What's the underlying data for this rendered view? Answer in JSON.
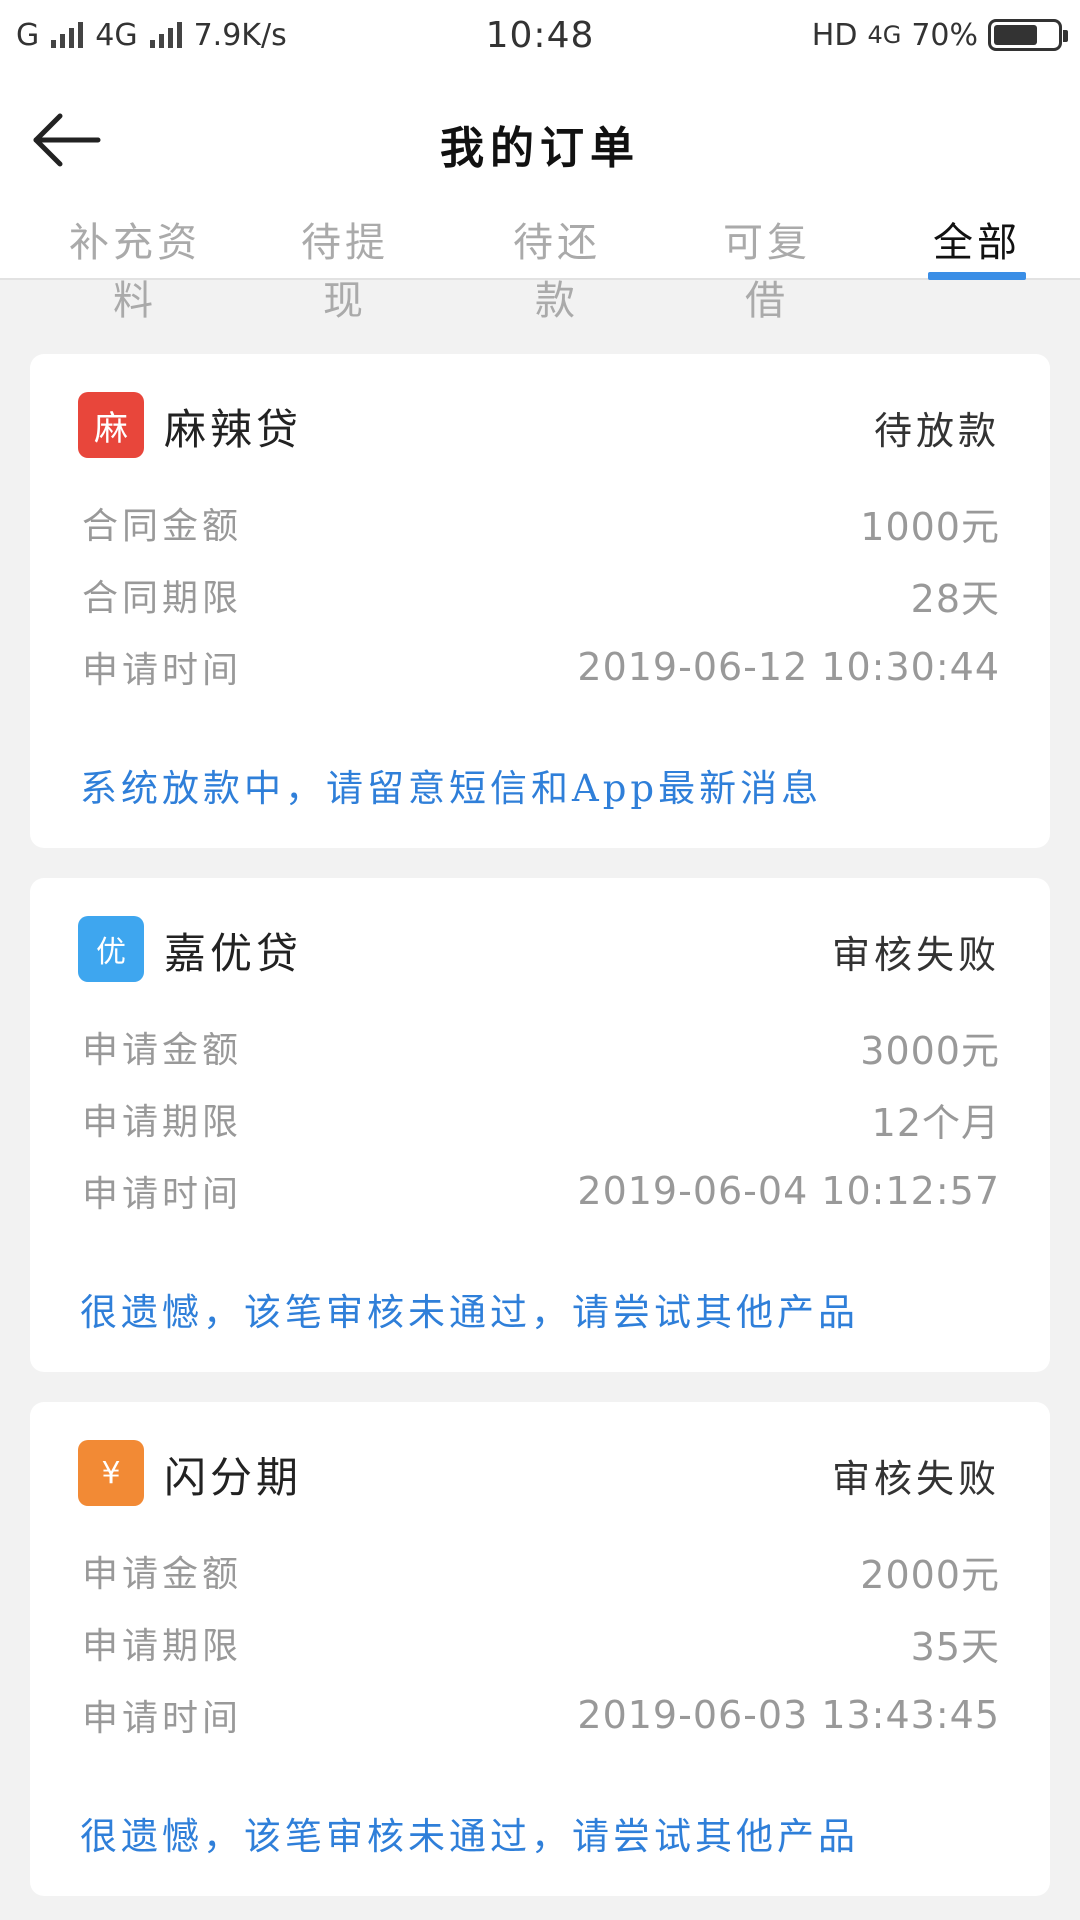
{
  "status_bar": {
    "carrier": "G",
    "network": "4G",
    "speed": "7.9K/s",
    "time": "10:48",
    "hd": "HD",
    "net2": "4G",
    "battery_text": "70%",
    "battery_level": 0.7
  },
  "header": {
    "title": "我的订单",
    "back_icon": "arrow-left-icon"
  },
  "tabs": [
    {
      "label": "补充资料",
      "active": false
    },
    {
      "label": "待提现",
      "active": false
    },
    {
      "label": "待还款",
      "active": false
    },
    {
      "label": "可复借",
      "active": false
    },
    {
      "label": "全部",
      "active": true
    }
  ],
  "accent_color": "#3a8ee6",
  "message_color": "#2f7fd9",
  "orders": [
    {
      "logo_text": "麻",
      "logo_color": "#e8463b",
      "name": "麻辣贷",
      "status": "待放款",
      "rows": [
        {
          "label": "合同金额",
          "value": "1000元"
        },
        {
          "label": "合同期限",
          "value": "28天"
        },
        {
          "label": "申请时间",
          "value": "2019-06-12 10:30:44"
        }
      ],
      "message": "系统放款中，请留意短信和App最新消息"
    },
    {
      "logo_text": "优",
      "logo_color": "#3ea6ef",
      "name": "嘉优贷",
      "status": "审核失败",
      "rows": [
        {
          "label": "申请金额",
          "value": "3000元"
        },
        {
          "label": "申请期限",
          "value": "12个月"
        },
        {
          "label": "申请时间",
          "value": "2019-06-04 10:12:57"
        }
      ],
      "message": "很遗憾，该笔审核未通过，请尝试其他产品"
    },
    {
      "logo_text": "¥",
      "logo_color": "#f28a35",
      "name": "闪分期",
      "status": "审核失败",
      "rows": [
        {
          "label": "申请金额",
          "value": "2000元"
        },
        {
          "label": "申请期限",
          "value": "35天"
        },
        {
          "label": "申请时间",
          "value": "2019-06-03 13:43:45"
        }
      ],
      "message": "很遗憾，该笔审核未通过，请尝试其他产品"
    }
  ]
}
